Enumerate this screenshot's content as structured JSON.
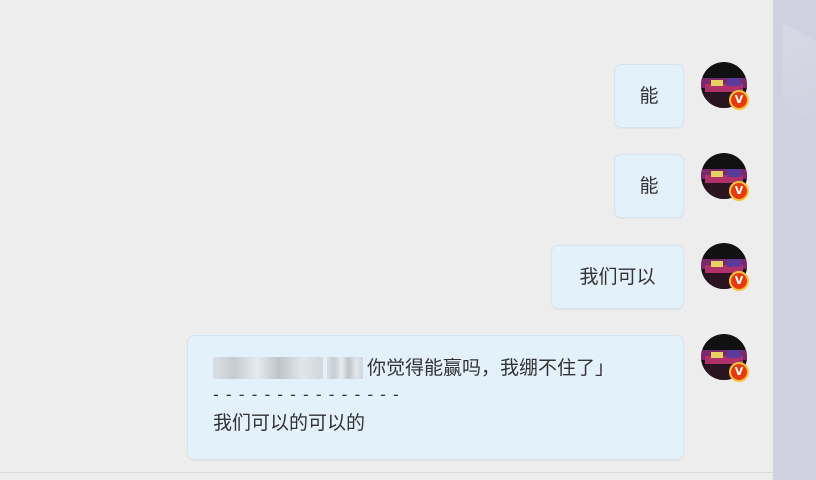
{
  "messages": [
    {
      "text": "能"
    },
    {
      "text": "能"
    },
    {
      "text": "我们可以"
    },
    {
      "quote_text": "你觉得能赢吗，我绷不住了」",
      "divider": "- - - - - - - - - - - - - - -",
      "reply": "我们可以的可以的"
    }
  ],
  "avatar_badge": "V",
  "colors": {
    "bubble": "#e3f1fb",
    "background": "#ededed",
    "badge": "#e8380d"
  }
}
